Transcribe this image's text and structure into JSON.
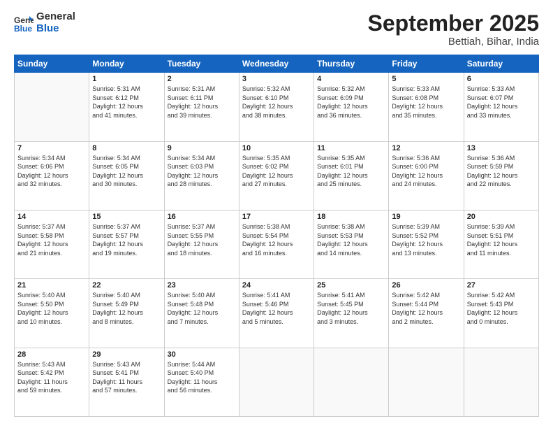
{
  "header": {
    "logo_general": "General",
    "logo_blue": "Blue",
    "month_title": "September 2025",
    "subtitle": "Bettiah, Bihar, India"
  },
  "weekdays": [
    "Sunday",
    "Monday",
    "Tuesday",
    "Wednesday",
    "Thursday",
    "Friday",
    "Saturday"
  ],
  "weeks": [
    [
      {
        "day": "",
        "info": ""
      },
      {
        "day": "1",
        "info": "Sunrise: 5:31 AM\nSunset: 6:12 PM\nDaylight: 12 hours\nand 41 minutes."
      },
      {
        "day": "2",
        "info": "Sunrise: 5:31 AM\nSunset: 6:11 PM\nDaylight: 12 hours\nand 39 minutes."
      },
      {
        "day": "3",
        "info": "Sunrise: 5:32 AM\nSunset: 6:10 PM\nDaylight: 12 hours\nand 38 minutes."
      },
      {
        "day": "4",
        "info": "Sunrise: 5:32 AM\nSunset: 6:09 PM\nDaylight: 12 hours\nand 36 minutes."
      },
      {
        "day": "5",
        "info": "Sunrise: 5:33 AM\nSunset: 6:08 PM\nDaylight: 12 hours\nand 35 minutes."
      },
      {
        "day": "6",
        "info": "Sunrise: 5:33 AM\nSunset: 6:07 PM\nDaylight: 12 hours\nand 33 minutes."
      }
    ],
    [
      {
        "day": "7",
        "info": "Sunrise: 5:34 AM\nSunset: 6:06 PM\nDaylight: 12 hours\nand 32 minutes."
      },
      {
        "day": "8",
        "info": "Sunrise: 5:34 AM\nSunset: 6:05 PM\nDaylight: 12 hours\nand 30 minutes."
      },
      {
        "day": "9",
        "info": "Sunrise: 5:34 AM\nSunset: 6:03 PM\nDaylight: 12 hours\nand 28 minutes."
      },
      {
        "day": "10",
        "info": "Sunrise: 5:35 AM\nSunset: 6:02 PM\nDaylight: 12 hours\nand 27 minutes."
      },
      {
        "day": "11",
        "info": "Sunrise: 5:35 AM\nSunset: 6:01 PM\nDaylight: 12 hours\nand 25 minutes."
      },
      {
        "day": "12",
        "info": "Sunrise: 5:36 AM\nSunset: 6:00 PM\nDaylight: 12 hours\nand 24 minutes."
      },
      {
        "day": "13",
        "info": "Sunrise: 5:36 AM\nSunset: 5:59 PM\nDaylight: 12 hours\nand 22 minutes."
      }
    ],
    [
      {
        "day": "14",
        "info": "Sunrise: 5:37 AM\nSunset: 5:58 PM\nDaylight: 12 hours\nand 21 minutes."
      },
      {
        "day": "15",
        "info": "Sunrise: 5:37 AM\nSunset: 5:57 PM\nDaylight: 12 hours\nand 19 minutes."
      },
      {
        "day": "16",
        "info": "Sunrise: 5:37 AM\nSunset: 5:55 PM\nDaylight: 12 hours\nand 18 minutes."
      },
      {
        "day": "17",
        "info": "Sunrise: 5:38 AM\nSunset: 5:54 PM\nDaylight: 12 hours\nand 16 minutes."
      },
      {
        "day": "18",
        "info": "Sunrise: 5:38 AM\nSunset: 5:53 PM\nDaylight: 12 hours\nand 14 minutes."
      },
      {
        "day": "19",
        "info": "Sunrise: 5:39 AM\nSunset: 5:52 PM\nDaylight: 12 hours\nand 13 minutes."
      },
      {
        "day": "20",
        "info": "Sunrise: 5:39 AM\nSunset: 5:51 PM\nDaylight: 12 hours\nand 11 minutes."
      }
    ],
    [
      {
        "day": "21",
        "info": "Sunrise: 5:40 AM\nSunset: 5:50 PM\nDaylight: 12 hours\nand 10 minutes."
      },
      {
        "day": "22",
        "info": "Sunrise: 5:40 AM\nSunset: 5:49 PM\nDaylight: 12 hours\nand 8 minutes."
      },
      {
        "day": "23",
        "info": "Sunrise: 5:40 AM\nSunset: 5:48 PM\nDaylight: 12 hours\nand 7 minutes."
      },
      {
        "day": "24",
        "info": "Sunrise: 5:41 AM\nSunset: 5:46 PM\nDaylight: 12 hours\nand 5 minutes."
      },
      {
        "day": "25",
        "info": "Sunrise: 5:41 AM\nSunset: 5:45 PM\nDaylight: 12 hours\nand 3 minutes."
      },
      {
        "day": "26",
        "info": "Sunrise: 5:42 AM\nSunset: 5:44 PM\nDaylight: 12 hours\nand 2 minutes."
      },
      {
        "day": "27",
        "info": "Sunrise: 5:42 AM\nSunset: 5:43 PM\nDaylight: 12 hours\nand 0 minutes."
      }
    ],
    [
      {
        "day": "28",
        "info": "Sunrise: 5:43 AM\nSunset: 5:42 PM\nDaylight: 11 hours\nand 59 minutes."
      },
      {
        "day": "29",
        "info": "Sunrise: 5:43 AM\nSunset: 5:41 PM\nDaylight: 11 hours\nand 57 minutes."
      },
      {
        "day": "30",
        "info": "Sunrise: 5:44 AM\nSunset: 5:40 PM\nDaylight: 11 hours\nand 56 minutes."
      },
      {
        "day": "",
        "info": ""
      },
      {
        "day": "",
        "info": ""
      },
      {
        "day": "",
        "info": ""
      },
      {
        "day": "",
        "info": ""
      }
    ]
  ]
}
